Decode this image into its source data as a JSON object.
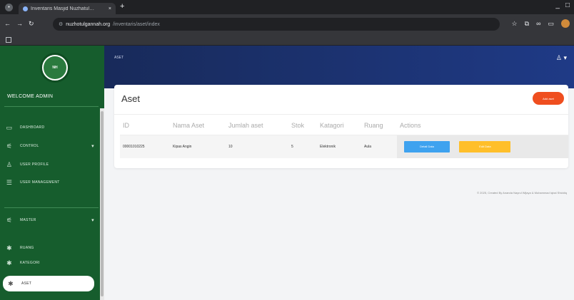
{
  "browser": {
    "tab_title": "Inventaris Masjid Nuzhatul…",
    "url_host": "nuzhotulgannah.org",
    "url_path": "/inventaris/aset/index",
    "new_tab": "+",
    "win_controls": [
      "_",
      "□"
    ]
  },
  "sidebar": {
    "logo_text": "NH",
    "welcome": "WELCOME ADMIN",
    "items": [
      {
        "label": "DASHBOARD",
        "icon": "monitor-icon"
      },
      {
        "label": "CONTROL",
        "icon": "sliders-icon",
        "chevron": "▾"
      },
      {
        "label": "USER PROFILE",
        "icon": "user-icon"
      },
      {
        "label": "USER MANAGEMENT",
        "icon": "list-icon"
      },
      {
        "label": "MASTER",
        "icon": "sliders-icon",
        "chevron": "▾"
      },
      {
        "label": "RUANG",
        "icon": "gear-icon"
      },
      {
        "label": "KATEGORI",
        "icon": "gear-icon"
      },
      {
        "label": "ASET",
        "icon": "gear-icon"
      }
    ]
  },
  "topnav": {
    "breadcrumb": "ASET",
    "user_icon": "user-icon"
  },
  "card": {
    "title": "Aset",
    "add_button": "Add aset",
    "columns": [
      "ID",
      "Nama Aset",
      "Jumlah aset",
      "Stok",
      "Katagori",
      "Ruang",
      "Actions"
    ],
    "rows": [
      {
        "id": "00001010225",
        "nama": "Kipas Angin",
        "jumlah": "10",
        "stok": "5",
        "kategori": "Elektronik",
        "ruang": "Aula",
        "detail_label": "Detail Data",
        "edit_label": "Edit Data"
      }
    ]
  },
  "footer": {
    "text": "© 2025, Created By Ananda Nayrul Wijaya & Muhammad Iqbal Shiddiq"
  },
  "colors": {
    "sidebar": "#165d2d",
    "topnav": "#1f3a86",
    "add_button": "#ef4e1f",
    "detail_button": "#3ea2ef",
    "edit_button": "#ffbf2a"
  }
}
